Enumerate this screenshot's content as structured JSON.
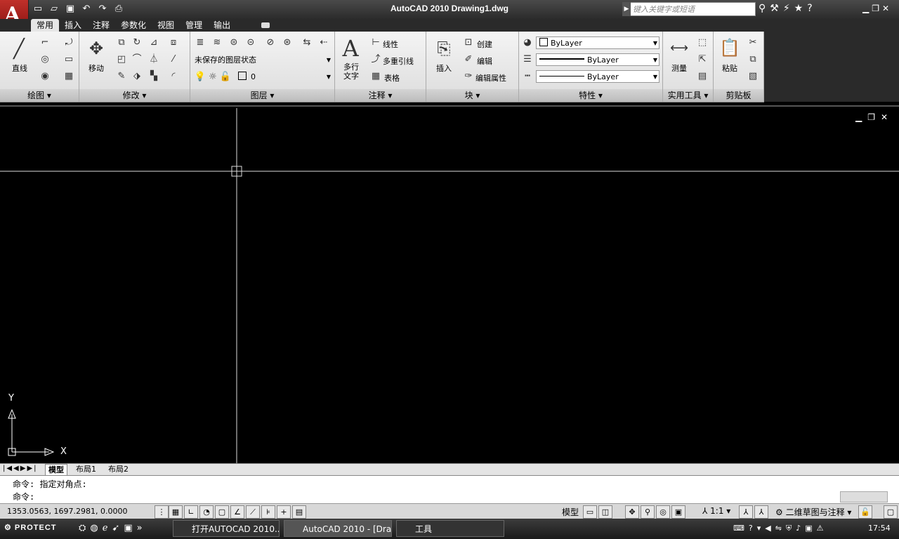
{
  "window": {
    "title": "AutoCAD 2010    Drawing1.dwg",
    "search_placeholder": "键入关键字或短语"
  },
  "tabs": [
    "常用",
    "插入",
    "注释",
    "参数化",
    "视图",
    "管理",
    "输出"
  ],
  "panels": {
    "draw": {
      "title": "绘图",
      "line_label": "直线"
    },
    "modify": {
      "title": "修改",
      "move_label": "移动"
    },
    "layers": {
      "title": "图层",
      "state_value": "未保存的图层状态",
      "layer_value": "0"
    },
    "annotation": {
      "title": "注释",
      "mtext_label_1": "多行",
      "mtext_label_2": "文字",
      "linear_label": "线性",
      "multileader_label": "多重引线",
      "table_label": "表格"
    },
    "block": {
      "title": "块",
      "insert_label": "插入",
      "create_label": "创建",
      "edit_label": "编辑",
      "edit_attr_label": "编辑属性"
    },
    "properties": {
      "title": "特性",
      "color_value": "ByLayer",
      "linetype_value": "ByLayer",
      "lineweight_value": "ByLayer"
    },
    "utilities": {
      "title": "实用工具",
      "measure_label": "测量"
    },
    "clipboard": {
      "title": "剪贴板",
      "paste_label": "粘贴"
    }
  },
  "layout_tabs": [
    "模型",
    "布局1",
    "布局2"
  ],
  "command": {
    "history": "命令: 指定对角点:",
    "prompt": "命令:"
  },
  "status": {
    "coords": "1353.0563,  1697.2981,  0.0000",
    "model_label": "模型",
    "scale": "1:1",
    "workspace": "二维草图与注释"
  },
  "ucs": {
    "x_label": "X",
    "y_label": "Y"
  },
  "taskbar": {
    "start_label": "PROTECT",
    "tasks": [
      "打开AUTOCAD 2010...",
      "AutoCAD 2010 - [Dra...",
      "工具"
    ],
    "time": "17:54"
  }
}
